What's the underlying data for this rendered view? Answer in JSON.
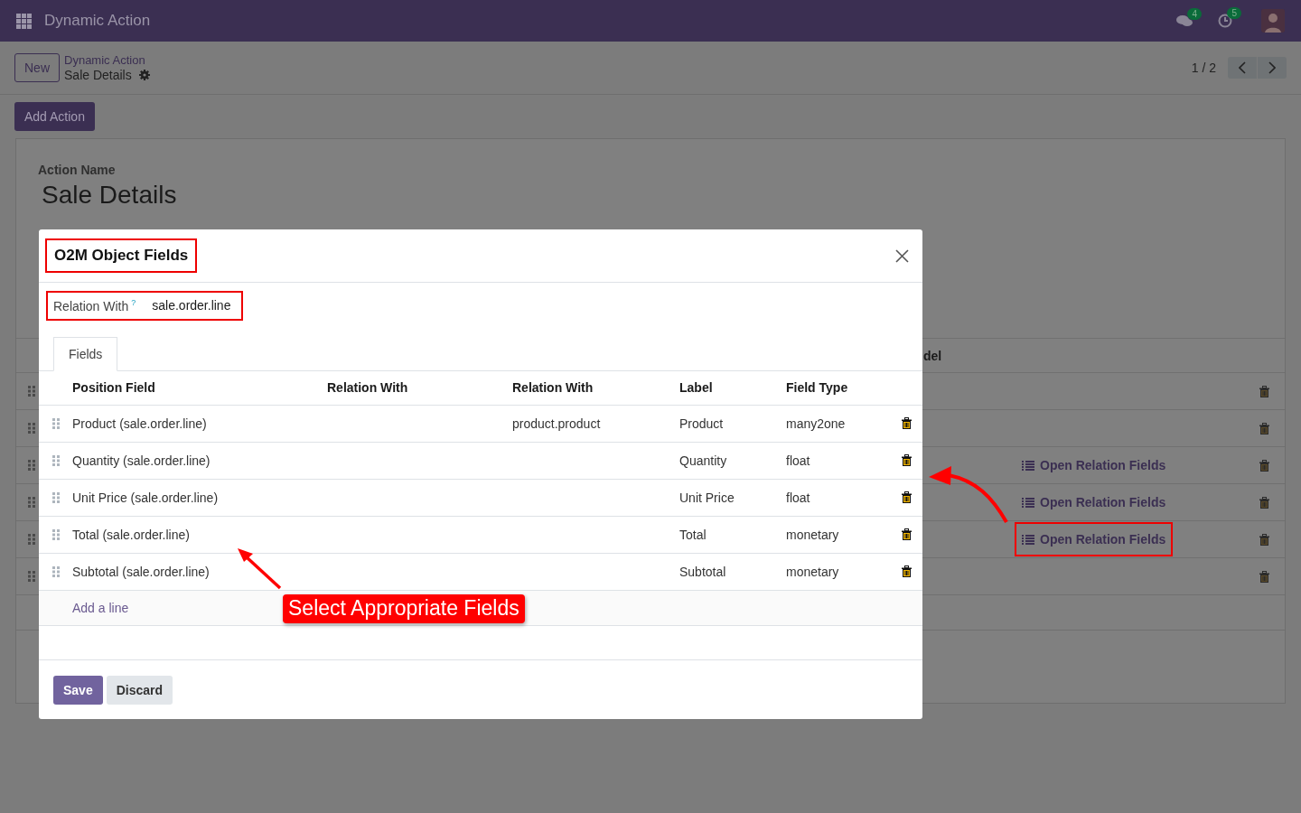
{
  "navbar": {
    "app_name": "Dynamic Action",
    "chat_count": "4",
    "activity_count": "5"
  },
  "control_panel": {
    "new_button": "New",
    "breadcrumb_parent": "Dynamic Action",
    "breadcrumb_current": "Sale Details",
    "pager": "1 / 2"
  },
  "add_action_button": "Add Action",
  "form": {
    "field_label": "Action Name",
    "action_name": "Sale Details",
    "list": {
      "header_fragment": "del",
      "rows": [
        {
          "kind": "plain"
        },
        {
          "kind": "plain"
        },
        {
          "kind": "relation",
          "relation_button": "Open Relation Fields",
          "highlighted": false
        },
        {
          "kind": "relation",
          "relation_button": "Open Relation Fields",
          "highlighted": false
        },
        {
          "kind": "relation",
          "relation_button": "Open Relation Fields",
          "highlighted": true
        },
        {
          "kind": "plain"
        }
      ]
    }
  },
  "dialog": {
    "title": "O2M Object Fields",
    "title_highlighted": true,
    "relation_field": {
      "label": "Relation With",
      "help_mark": "?",
      "value": "sale.order.line",
      "highlighted": true
    },
    "tabs": [
      {
        "label": "Fields",
        "selected": true
      }
    ],
    "columns": [
      "Position Field",
      "Relation With",
      "Relation With",
      "Label",
      "Field Type"
    ],
    "rows": [
      {
        "position_field": "Product (sale.order.line)",
        "relation_model": "product.product",
        "label": "Product",
        "field_type": "many2one"
      },
      {
        "position_field": "Quantity (sale.order.line)",
        "label": "Quantity",
        "field_type": "float"
      },
      {
        "position_field": "Unit Price (sale.order.line)",
        "label": "Unit Price",
        "field_type": "float"
      },
      {
        "position_field": "Total (sale.order.line)",
        "label": "Total",
        "field_type": "monetary"
      },
      {
        "position_field": "Subtotal (sale.order.line)",
        "label": "Subtotal",
        "field_type": "monetary"
      }
    ],
    "add_line": "Add a line",
    "buttons": [
      {
        "label": "Save",
        "kind": "primary"
      },
      {
        "label": "Discard",
        "kind": "secondary"
      }
    ]
  },
  "annotation": {
    "callout": "Select Appropriate Fields"
  }
}
